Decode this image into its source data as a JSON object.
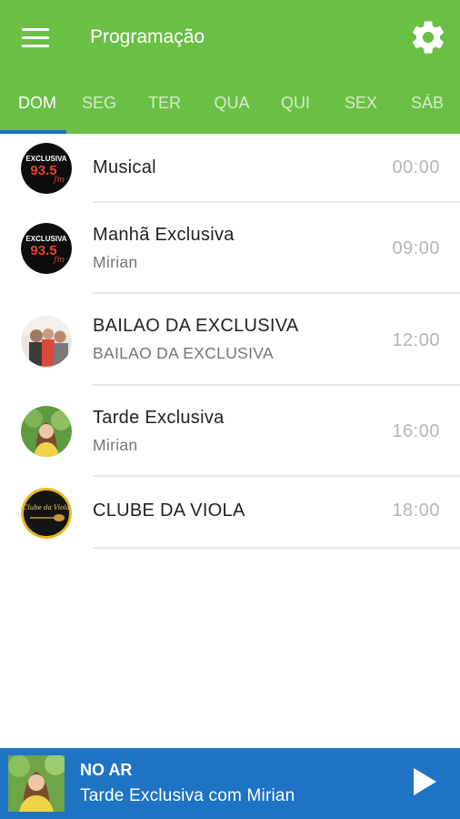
{
  "appbar": {
    "title": "Programação",
    "menu_icon": "hamburger-menu-icon",
    "settings_icon": "gear-icon",
    "background": "#6abf45"
  },
  "tabs": [
    {
      "label": "DOM",
      "active": true
    },
    {
      "label": "SEG",
      "active": false
    },
    {
      "label": "TER",
      "active": false
    },
    {
      "label": "QUA",
      "active": false
    },
    {
      "label": "QUI",
      "active": false
    },
    {
      "label": "SEX",
      "active": false
    },
    {
      "label": "SÁB",
      "active": false
    }
  ],
  "tab_indicator_color": "#1a73c9",
  "schedule": [
    {
      "title": "Musical",
      "subtitle": "",
      "time": "00:00",
      "avatar": "exclusiva-93-5-fm-logo"
    },
    {
      "title": "Manhã Exclusiva",
      "subtitle": "Mirian",
      "time": "09:00",
      "avatar": "exclusiva-93-5-fm-logo"
    },
    {
      "title": "BAILAO DA EXCLUSIVA",
      "subtitle": "BAILAO DA EXCLUSIVA",
      "time": "12:00",
      "avatar": "band-photo"
    },
    {
      "title": "Tarde Exclusiva",
      "subtitle": "Mirian",
      "time": "16:00",
      "avatar": "host-photo"
    },
    {
      "title": "CLUBE DA VIOLA",
      "subtitle": "",
      "time": "18:00",
      "avatar": "clube-da-viola-logo"
    }
  ],
  "logo_text": {
    "exclusiva": "EXCLUSIVA",
    "frequency": "93.5",
    "band": "fm",
    "viola": "Clube da Viola"
  },
  "player": {
    "status": "NO AR",
    "now_playing": "Tarde Exclusiva com Mirian",
    "play_icon": "play-icon",
    "background": "#1f73c4"
  }
}
